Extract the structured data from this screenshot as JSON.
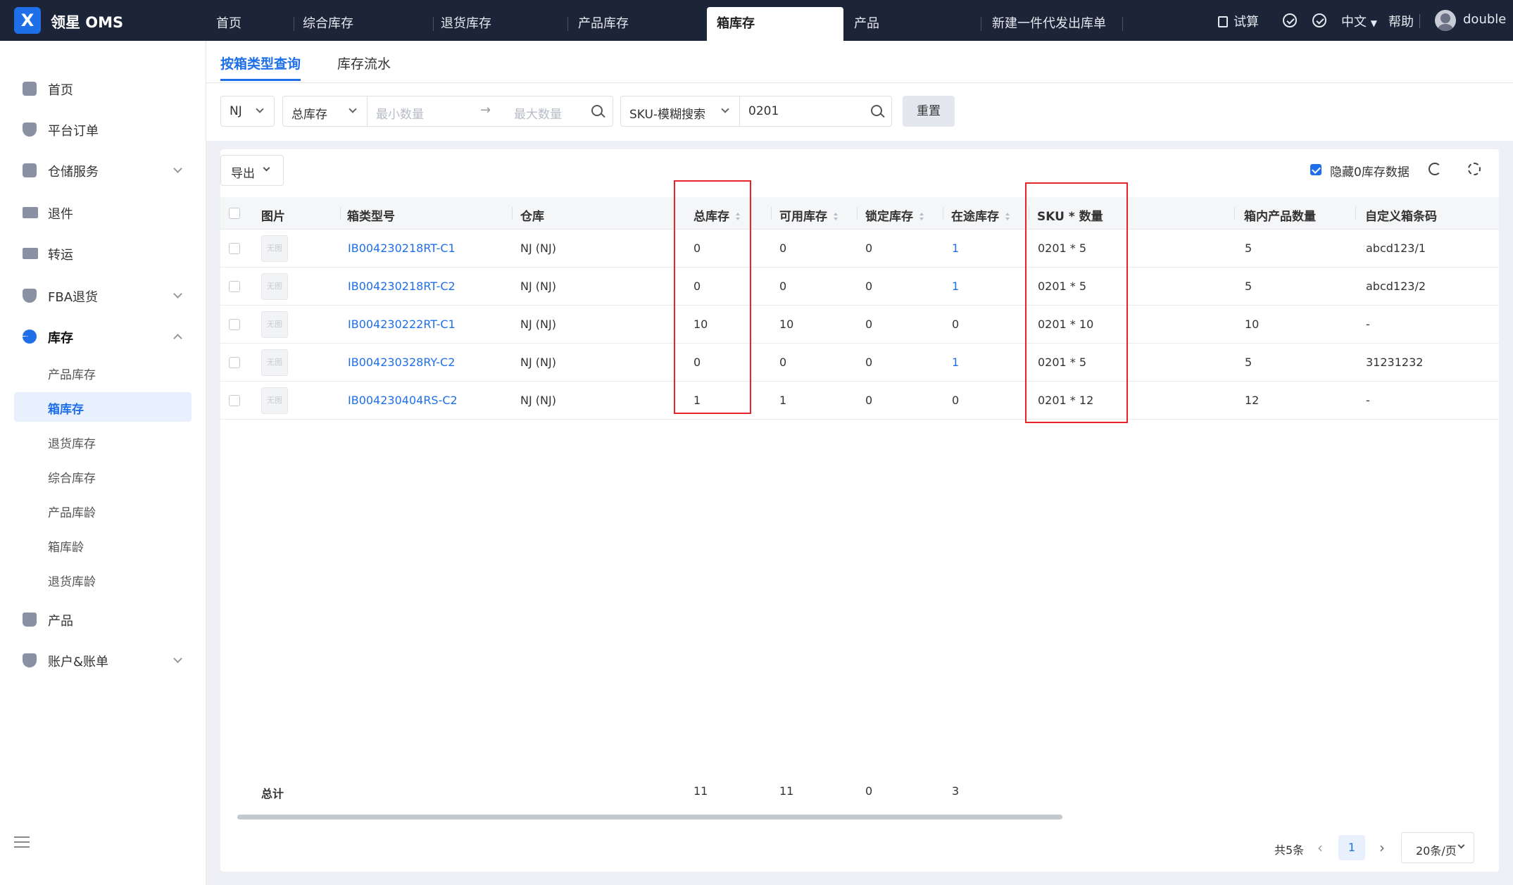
{
  "app": {
    "logo_icon": "x-logo-icon",
    "brand": "领星 OMS"
  },
  "top_tabs": [
    {
      "label": "首页"
    },
    {
      "label": "综合库存"
    },
    {
      "label": "退货库存"
    },
    {
      "label": "产品库存"
    },
    {
      "label": "箱库存",
      "active": true
    },
    {
      "label": "产品"
    },
    {
      "label": "新建一件代发出库单"
    }
  ],
  "top_right": {
    "calc": "试算",
    "lang": "中文",
    "help": "帮助",
    "user": "double"
  },
  "sidebar": {
    "items": [
      {
        "label": "首页",
        "icon": "home-icon"
      },
      {
        "label": "平台订单",
        "icon": "shield-icon"
      },
      {
        "label": "仓储服务",
        "icon": "warehouse-icon"
      },
      {
        "label": "退件",
        "icon": "truck-icon"
      },
      {
        "label": "转运",
        "icon": "truck-icon"
      },
      {
        "label": "FBA退货",
        "icon": "shield-icon"
      },
      {
        "label": "库存",
        "icon": "pie-chart-icon"
      },
      {
        "label": "产品",
        "icon": "bag-icon"
      },
      {
        "label": "账户&账单",
        "icon": "shield-icon"
      }
    ],
    "sub_items": [
      {
        "label": "产品库存"
      },
      {
        "label": "箱库存",
        "active": true
      },
      {
        "label": "退货库存"
      },
      {
        "label": "综合库存"
      },
      {
        "label": "产品库龄"
      },
      {
        "label": "箱库龄"
      },
      {
        "label": "退货库龄"
      }
    ]
  },
  "subtabs": [
    {
      "label": "按箱类型查询",
      "active": true
    },
    {
      "label": "库存流水"
    }
  ],
  "filters": {
    "warehouse": "NJ",
    "stock_type": "总库存",
    "min_placeholder": "最小数量",
    "max_placeholder": "最大数量",
    "search_type": "SKU-模糊搜索",
    "search_value": "0201",
    "reset_label": "重置"
  },
  "toolbar": {
    "export_label": "导出",
    "hide_zero_label": "隐藏0库存数据",
    "hide_zero_checked": true
  },
  "table": {
    "headers": {
      "image": "图片",
      "box_type": "箱类型号",
      "warehouse": "仓库",
      "total": "总库存",
      "available": "可用库存",
      "locked": "锁定库存",
      "in_transit": "在途库存",
      "sku_qty": "SKU * 数量",
      "box_qty": "箱内产品数量",
      "barcode": "自定义箱条码"
    },
    "no_image_label": "无图",
    "rows": [
      {
        "box_type": "IB004230218RT-C1",
        "warehouse": "NJ (NJ)",
        "total": "0",
        "available": "0",
        "locked": "0",
        "in_transit": "1",
        "sku_qty": "0201 * 5",
        "box_qty": "5",
        "barcode": "abcd123/1"
      },
      {
        "box_type": "IB004230218RT-C2",
        "warehouse": "NJ (NJ)",
        "total": "0",
        "available": "0",
        "locked": "0",
        "in_transit": "1",
        "sku_qty": "0201 * 5",
        "box_qty": "5",
        "barcode": "abcd123/2"
      },
      {
        "box_type": "IB004230222RT-C1",
        "warehouse": "NJ (NJ)",
        "total": "10",
        "available": "10",
        "locked": "0",
        "in_transit": "0",
        "sku_qty": "0201 * 10",
        "box_qty": "10",
        "barcode": "-"
      },
      {
        "box_type": "IB004230328RY-C2",
        "warehouse": "NJ (NJ)",
        "total": "0",
        "available": "0",
        "locked": "0",
        "in_transit": "1",
        "sku_qty": "0201 * 5",
        "box_qty": "5",
        "barcode": "31231232"
      },
      {
        "box_type": "IB004230404RS-C2",
        "warehouse": "NJ (NJ)",
        "total": "1",
        "available": "1",
        "locked": "0",
        "in_transit": "0",
        "sku_qty": "0201 * 12",
        "box_qty": "12",
        "barcode": "-"
      }
    ],
    "totals": {
      "label": "总计",
      "total": "11",
      "available": "11",
      "locked": "0",
      "in_transit": "3"
    }
  },
  "pagination": {
    "total_text": "共5条",
    "current_page": "1",
    "page_size": "20条/页"
  },
  "colors": {
    "accent": "#1f6fe8",
    "topbar": "#1c2438",
    "highlight": "#e8242b"
  }
}
